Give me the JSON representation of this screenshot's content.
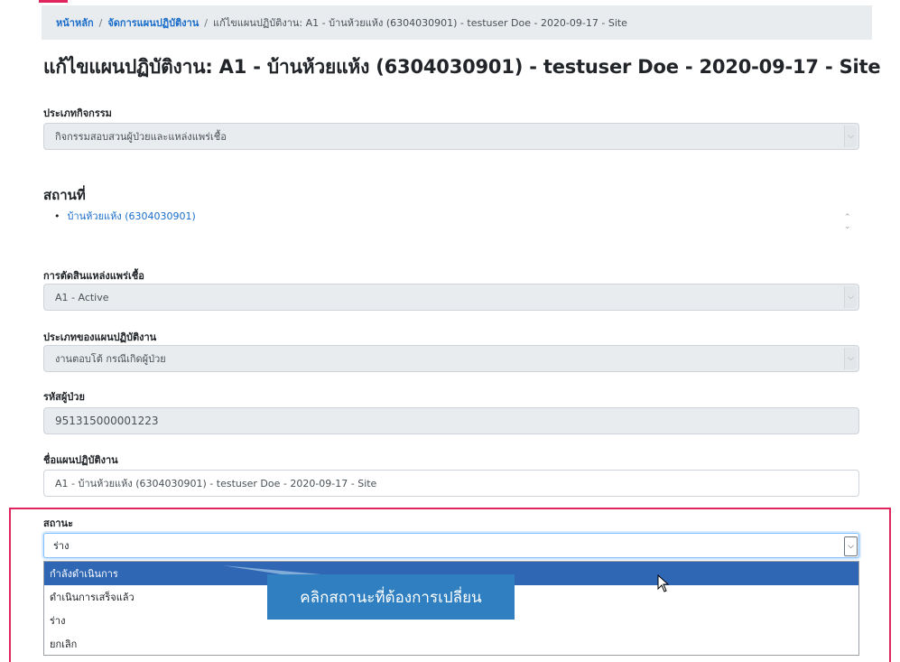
{
  "breadcrumb": {
    "home": "หน้าหลัก",
    "manage": "จัดการแผนปฏิบัติงาน",
    "current": "แก้ไขแผนปฏิบัติงาน: A1 - บ้านห้วยแห้ง (6304030901) - testuser Doe - 2020-09-17 - Site",
    "separator": "/"
  },
  "page_title": "แก้ไขแผนปฏิบัติงาน: A1 - บ้านห้วยแห้ง (6304030901) - testuser Doe - 2020-09-17 - Site",
  "activity_type": {
    "label": "ประเภทกิจกรรม",
    "value": "กิจกรรมสอบสวนผู้ป่วยและแหล่งแพร่เชื้อ"
  },
  "place": {
    "heading": "สถานที่",
    "items": [
      "บ้านห้วยแห้ง (6304030901)"
    ]
  },
  "source_decision": {
    "label": "การตัดสินแหล่งแพร่เชื้อ",
    "value": "A1 - Active"
  },
  "plan_type": {
    "label": "ประเภทของแผนปฏิบัติงาน",
    "value": "งานตอบโต้ กรณีเกิดผู้ป่วย"
  },
  "patient_code": {
    "label": "รหัสผู้ป่วย",
    "value": "951315000001223"
  },
  "plan_name": {
    "label": "ชื่อแผนปฏิบัติงาน",
    "value": "A1 - บ้านห้วยแห้ง (6304030901) - testuser Doe - 2020-09-17 - Site"
  },
  "status": {
    "label": "สถานะ",
    "value": "ร่าง",
    "options": [
      "กำลังดำเนินการ",
      "ดำเนินการเสร็จแล้ว",
      "ร่าง",
      "ยกเลิก"
    ],
    "highlighted": "กำลังดำเนินการ"
  },
  "callout": {
    "text": "คลิกสถานะที่ต้องการเปลี่ยน"
  },
  "icons": {
    "dropdown_arrow": "chevron-down-icon",
    "spinner": "spinner-icon",
    "cursor": "mouse-cursor-icon"
  },
  "colors": {
    "accent": "#e0245e",
    "link": "#1a6dc9",
    "selected_option": "#2f67b5",
    "callout": "#2f7fc1"
  }
}
